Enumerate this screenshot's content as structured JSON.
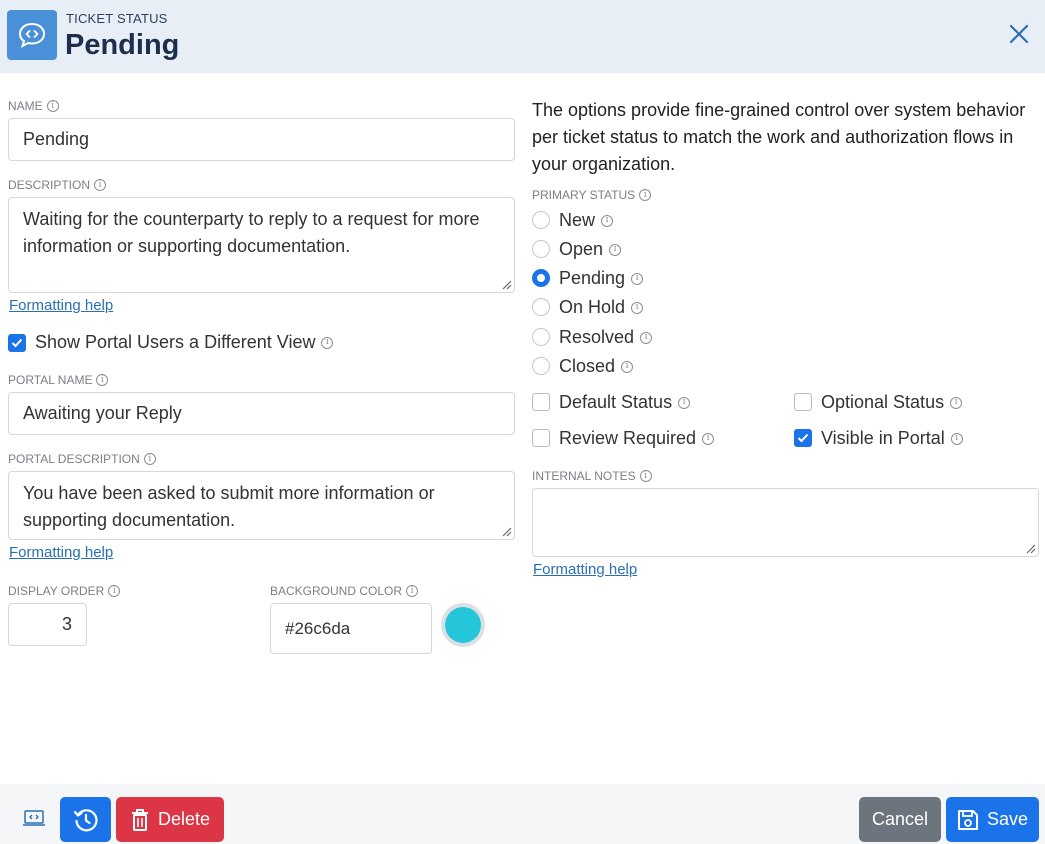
{
  "header": {
    "kicker": "TICKET STATUS",
    "title": "Pending"
  },
  "left": {
    "name_label": "NAME",
    "name_value": "Pending",
    "description_label": "DESCRIPTION",
    "description_value": "Waiting for the counterparty to reply to a request for more information or supporting documentation.",
    "formatting_help_1": "Formatting help",
    "show_portal_label": "Show Portal Users a Different View",
    "show_portal_checked": true,
    "portal_name_label": "PORTAL NAME",
    "portal_name_value": "Awaiting your Reply",
    "portal_description_label": "PORTAL DESCRIPTION",
    "portal_description_value": "You have been asked to submit more information or supporting documentation.",
    "formatting_help_2": "Formatting help",
    "display_order_label": "DISPLAY ORDER",
    "display_order_value": "3",
    "bg_color_label": "BACKGROUND COLOR",
    "bg_color_value": "#26c6da"
  },
  "right": {
    "intro": "The options provide fine-grained control over system behavior per ticket status to match the work and authorization flows in your organization.",
    "primary_status_label": "PRIMARY STATUS",
    "statuses": [
      {
        "label": "New",
        "checked": false
      },
      {
        "label": "Open",
        "checked": false
      },
      {
        "label": "Pending",
        "checked": true
      },
      {
        "label": "On Hold",
        "checked": false
      },
      {
        "label": "Resolved",
        "checked": false
      },
      {
        "label": "Closed",
        "checked": false
      }
    ],
    "default_status": "Default Status",
    "optional_status": "Optional Status",
    "review_required": "Review Required",
    "visible_in_portal": "Visible in Portal",
    "internal_notes_label": "INTERNAL NOTES",
    "internal_notes_value": "",
    "formatting_help_3": "Formatting help"
  },
  "footer": {
    "delete_label": "Delete",
    "cancel_label": "Cancel",
    "save_label": "Save"
  },
  "colors": {
    "accent": "#1a73e8",
    "delete": "#dc3545",
    "cancel": "#6c757d",
    "swatch": "#26c6da",
    "header_bg": "#e8eef5"
  },
  "icons": {
    "header": "chat-code-icon",
    "close": "close-icon",
    "info": "info-icon",
    "embed": "embed-icon",
    "history": "history-icon",
    "trash": "trash-icon",
    "save": "save-icon"
  }
}
